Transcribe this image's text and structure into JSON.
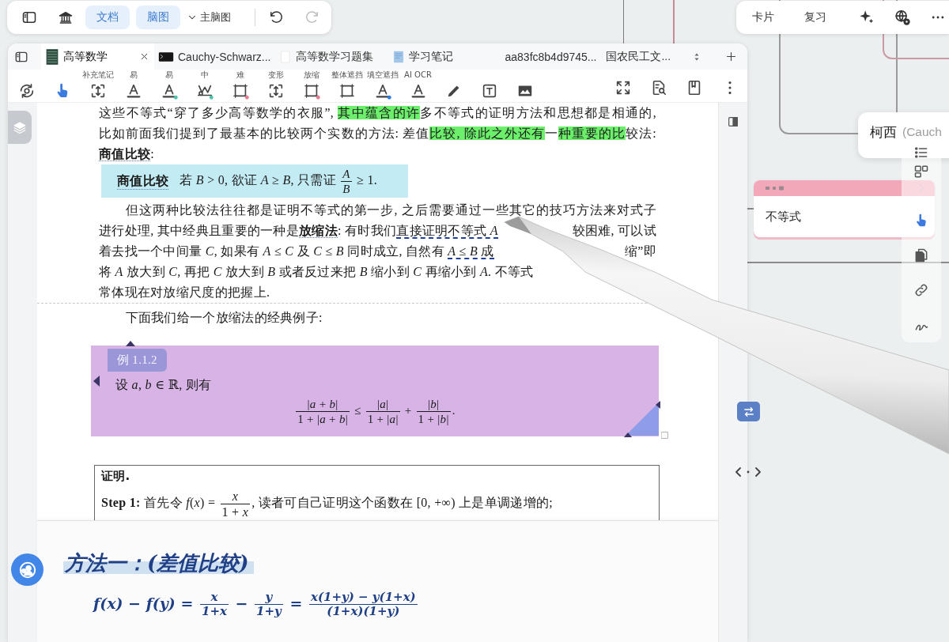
{
  "app_bar": {
    "toggles": [
      {
        "label": "文档",
        "selected": true
      },
      {
        "label": "脑图",
        "selected": true
      }
    ],
    "map_menu": "主脑图"
  },
  "review_bar": {
    "buttons": [
      "卡片",
      "复习"
    ]
  },
  "tabs": [
    {
      "label": "高等数学",
      "kind": "cover",
      "selected": true
    },
    {
      "label": "Cauchy-Schwarz...",
      "kind": "terminal",
      "selected": false
    },
    {
      "label": "高等数学习题集",
      "kind": "blank",
      "selected": false
    },
    {
      "label": "学习笔记",
      "kind": "notebook",
      "selected": false
    },
    {
      "label": "aa83fc8b4d9745...",
      "kind": "plain",
      "selected": false
    },
    {
      "label": "国农民工文...",
      "kind": "plain",
      "selected": false
    }
  ],
  "tools": [
    {
      "kind": "sync",
      "selected": false
    },
    {
      "kind": "hand",
      "selected": true
    },
    {
      "kind": "frame-arrows",
      "label": "补充笔记",
      "selected": false
    },
    {
      "kind": "letter",
      "label": "易",
      "selected": false
    },
    {
      "kind": "letter",
      "label": "易",
      "color": "#4cc3a9",
      "selected": false
    },
    {
      "kind": "mask",
      "label": "中",
      "color": "#4cc3a9",
      "selected": false
    },
    {
      "kind": "frame",
      "label": "难",
      "color": "#e77d93",
      "selected": false
    },
    {
      "kind": "frame-arrows",
      "label": "变形",
      "selected": false
    },
    {
      "kind": "frame",
      "label": "放缩",
      "color": "#e77d93",
      "selected": false
    },
    {
      "kind": "frame",
      "label": "整体遮挡",
      "selected": false
    },
    {
      "kind": "letter",
      "label": "填空遮挡",
      "color": "#2f7fe0",
      "selected": false
    },
    {
      "kind": "letter",
      "label": "AI OCR",
      "selected": false
    },
    {
      "kind": "pencil",
      "selected": false
    },
    {
      "kind": "text-box",
      "selected": false
    },
    {
      "kind": "image",
      "selected": false
    }
  ],
  "document": {
    "blocks": [
      {
        "kind": "paragraph",
        "continued": true,
        "lines": [
          {
            "kind": "full",
            "parts": [
              [
                "这些不等式“穿了多少高等数学的衣服”, ",
                {
                  "kind": "highlight",
                  "text": "其中蕴含的许"
                },
                "多不等式的证明方法和思想都是相通的,"
              ]
            ]
          },
          {
            "kind": "full",
            "parts": [
              [
                "比如前面我们提到了最基本的比较两个实数的方法: 差值",
                {
                  "kind": "highlight",
                  "text": "比较, 除此之外还有"
                },
                "一",
                {
                  "kind": "highlight",
                  "text": "种重要的比"
                },
                "较法:"
              ]
            ]
          },
          {
            "kind": "end",
            "parts": [
              [
                {
                  "kind": "term",
                  "text": "商值比较"
                },
                ":"
              ]
            ]
          }
        ]
      },
      {
        "kind": "definition",
        "term": "商值比较",
        "body": [
          "若 *B* > 0, 欲证 *A* ≥ *B*, 只需证 ",
          {
            "kind": "fraction",
            "num": "*A*",
            "den": "*B*"
          },
          " ≥ 1."
        ]
      },
      {
        "kind": "paragraph",
        "lines": [
          {
            "kind": "full",
            "parts": [
              [
                "但这两种比较法往往都是证明不等式的第一步, 之后需要通过一些其它的技巧方法来对式子"
              ]
            ]
          },
          {
            "kind": "split",
            "parts": [
              [
                "进行处理, 其中经典且重要的一种是",
                {
                  "kind": "term",
                  "text": "放缩法"
                },
                ": 有时我们",
                {
                  "kind": "dashed",
                  "text": "直接证明不等式 *A*"
                }
              ],
              [
                "较困难, 可以试"
              ]
            ]
          },
          {
            "kind": "split",
            "parts": [
              [
                "着去找一个中间量 *C*, 如果有 *A* ≤ *C* 及 *C* ≤ *B* 同时成立, 自然有 ",
                {
                  "kind": "dashed",
                  "text": "*A* ≤ *B* 成"
                }
              ],
              [
                "缩”即"
              ]
            ]
          },
          {
            "kind": "split",
            "parts": [
              [
                "将 *A* 放大到 *C*, 再把 *C* 放大到 *B* 或者反过来把 *B* 缩小到 *C* 再缩小到 *A*. 不等式"
              ]
            ]
          },
          {
            "kind": "end",
            "parts": [
              [
                "常体现在对放缩尺度的把握上."
              ]
            ]
          }
        ]
      },
      {
        "kind": "break"
      },
      {
        "kind": "paragraph",
        "lines": [
          {
            "kind": "end",
            "parts": [
              [
                "下面我们给一个放缩法的经典例子:"
              ]
            ]
          }
        ]
      },
      {
        "kind": "example",
        "label": "例 1.1.2",
        "intro": [
          "设 *a*, *b* ∈ ℝ, 则有"
        ],
        "formula": [
          {
            "kind": "fraction",
            "num": "|*a* + *b*|",
            "den": "1 + |*a* + *b*|"
          },
          " ≤ ",
          {
            "kind": "fraction",
            "num": "|*a*|",
            "den": "1 + |*a*|"
          },
          " + ",
          {
            "kind": "fraction",
            "num": "|*b*|",
            "den": "1 + |*b*|"
          },
          "."
        ]
      },
      {
        "kind": "proof",
        "title": "证明.",
        "steps": [
          {
            "label": "Step 1:",
            "body": [
              " 首先令 *f*(*x*) = ",
              {
                "kind": "fraction",
                "num": "*x*",
                "den": "1 + *x*"
              },
              ", 读者可自己证明这个函数在 [0, +∞) 上是单调递增的;"
            ]
          }
        ]
      }
    ]
  },
  "handwritten_note": {
    "title": "方法一：(差值比较)",
    "formula": [
      "f(x) − f(y) = ",
      {
        "kind": "fraction",
        "num": "x",
        "den": "1+x"
      },
      " − ",
      {
        "kind": "fraction",
        "num": "y",
        "den": "1+y"
      },
      " = ",
      {
        "kind": "fraction",
        "num": "x(1+y) − y(1+x)",
        "den": "(1+x)(1+y)"
      }
    ]
  },
  "mind_map": {
    "nodes": [
      {
        "kind": "plain",
        "title": "柯西",
        "note": "(Cauch"
      },
      {
        "kind": "tagged",
        "title": "不等式"
      }
    ]
  },
  "side_tools": [
    {
      "kind": "list",
      "selected": false
    },
    {
      "kind": "layout",
      "selected": false
    },
    {
      "kind": "hand",
      "selected": true
    },
    {
      "kind": "copy",
      "selected": false
    },
    {
      "kind": "link",
      "selected": false
    },
    {
      "kind": "squiggle",
      "selected": false
    }
  ]
}
